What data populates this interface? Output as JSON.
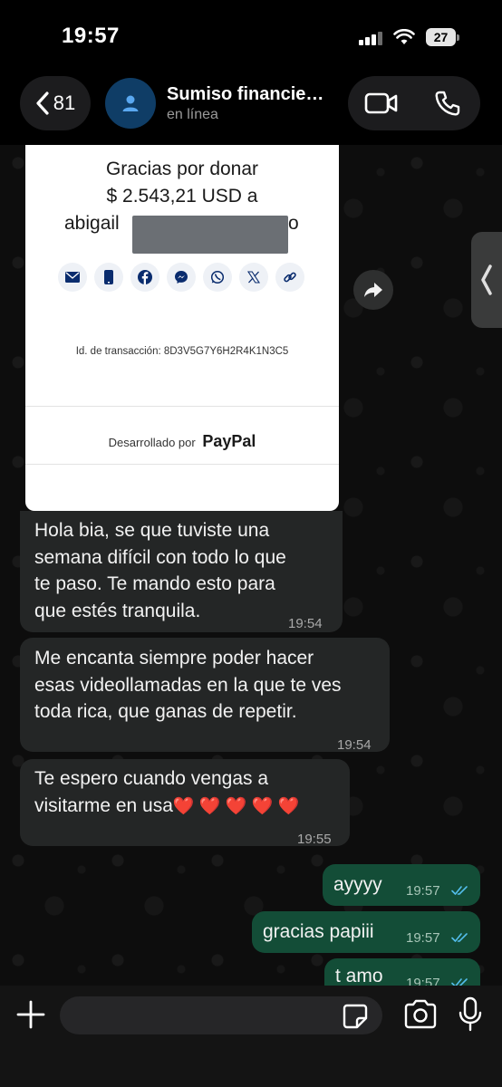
{
  "status_bar": {
    "time": "19:57",
    "battery": "27"
  },
  "header": {
    "back_count": "81",
    "contact_name": "Sumiso financie…",
    "contact_status": "en línea"
  },
  "paypal_card": {
    "thanks_line1": "Gracias por donar",
    "thanks_line2": "$ 2.543,21 USD a",
    "recipient_visible_start": "abigail",
    "recipient_visible_end": "o",
    "share_icons": [
      "email-icon",
      "phone-icon",
      "facebook-icon",
      "messenger-icon",
      "whatsapp-icon",
      "x-icon",
      "link-icon"
    ],
    "transaction_id": "Id. de transacción: 8D3V5G7Y6H2R4K1N3C5",
    "powered_by": "Desarrollado por",
    "brand": "PayPal"
  },
  "messages": {
    "m1": {
      "lines": [
        "Hola bia, se que tuviste una",
        "semana difícil con todo lo que",
        "te paso. Te mando esto para",
        "que estés tranquila."
      ],
      "time": "19:54"
    },
    "m2": {
      "lines": [
        "Me encanta siempre poder hacer",
        "esas videollamadas en la que te ves",
        "toda rica, que ganas de repetir."
      ],
      "time": "19:54"
    },
    "m3": {
      "lines": [
        "Te espero cuando vengas a",
        "visitarme en usa"
      ],
      "hearts": "❤️ ❤️ ❤️ ❤️ ❤️",
      "time": "19:55"
    },
    "m4": {
      "text": "ayyyy",
      "time": "19:57"
    },
    "m5": {
      "text": "gracias papiii",
      "time": "19:57"
    },
    "m6": {
      "text": "t amo",
      "time": "19:57"
    }
  },
  "colors": {
    "incoming_bubble": "#242626",
    "outgoing_bubble": "#134d37",
    "read_ticks": "#53bdeb",
    "avatar_bg": "#0f3d66"
  }
}
